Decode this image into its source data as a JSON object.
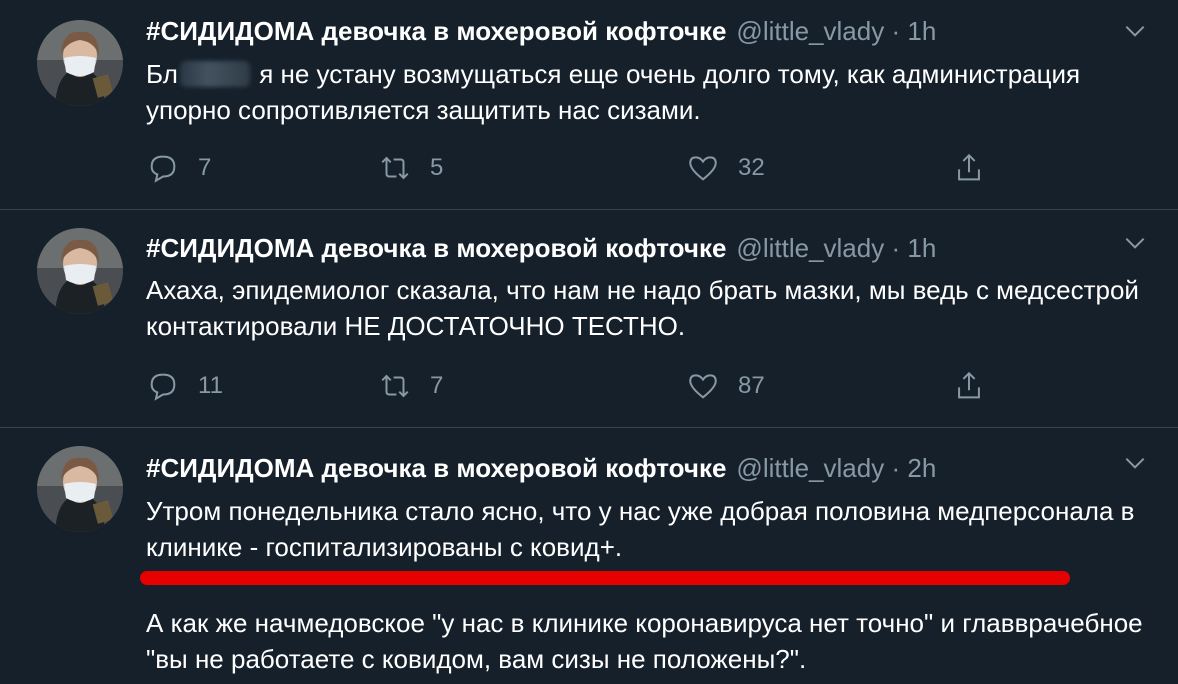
{
  "colors": {
    "background": "#15202b",
    "secondary_text": "#8899a6",
    "divider": "#38444d",
    "highlight_underline": "#e60000"
  },
  "tweets": [
    {
      "author_name": "#СИДИДОМА девочка в мохеровой кофточке",
      "handle": "@little_vlady",
      "separator": "·",
      "time": "1h",
      "text_before_redaction": "Бл",
      "text_after_redaction": "я не устану возмущаться еще очень долго тому, как администрация упорно сопротивляется защитить нас сизами.",
      "replies": "7",
      "retweets": "5",
      "likes": "32"
    },
    {
      "author_name": "#СИДИДОМА девочка в мохеровой кофточке",
      "handle": "@little_vlady",
      "separator": "·",
      "time": "1h",
      "text": "Ахаха, эпидемиолог сказала, что нам не надо брать мазки, мы ведь с медсестрой контактировали НЕ ДОСТАТОЧНО ТЕСТНО.",
      "replies": "11",
      "retweets": "7",
      "likes": "87"
    },
    {
      "author_name": "#СИДИДОМА девочка в мохеровой кофточке",
      "handle": "@little_vlady",
      "separator": "·",
      "time": "2h",
      "text": "Утром понедельника стало ясно, что у нас уже добрая половина медперсонала в клинике - госпитализированы с ковид+.",
      "text_second_paragraph": "А как же начмедовское \"у нас в клинике коронавируса нет точно\" и главврачебное \"вы не работаете с ковидом, вам сизы не положены?\"."
    }
  ],
  "icons": {
    "reply": "speech-bubble-icon",
    "retweet": "retweet-arrows-icon",
    "like": "heart-outline-icon",
    "share": "share-upload-icon",
    "more": "chevron-down-icon"
  }
}
